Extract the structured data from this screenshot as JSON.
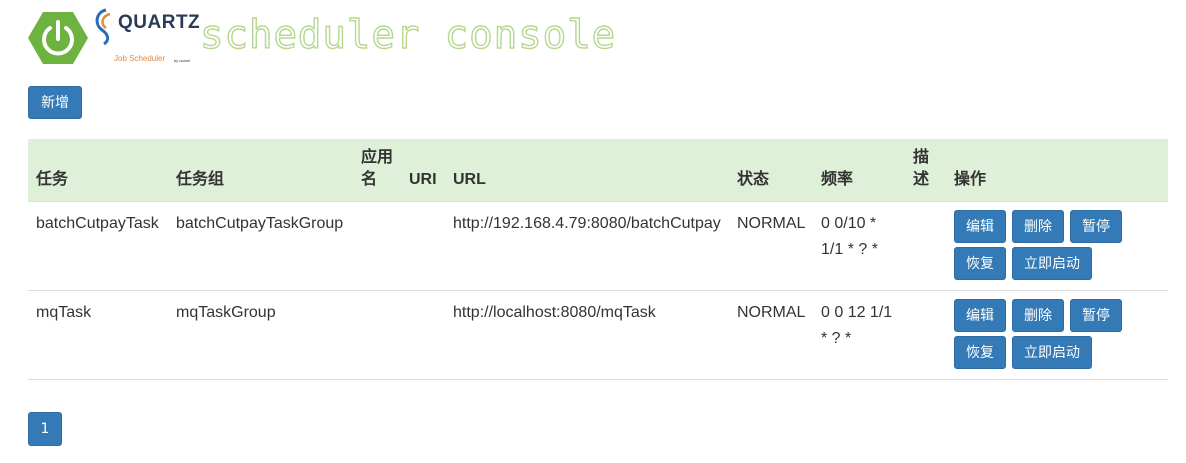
{
  "header": {
    "quartz_logo_text": "QUARTZ",
    "quartz_logo_sub": "Job Scheduler",
    "quartz_logo_mini": "by ocaml",
    "console_title": "scheduler console"
  },
  "toolbar": {
    "add_label": "新增"
  },
  "table": {
    "columns": [
      "任务",
      "任务组",
      "应用名",
      "URI",
      "URL",
      "状态",
      "频率",
      "描述",
      "操作"
    ],
    "rows": [
      {
        "task": "batchCutpayTask",
        "group": "batchCutpayTaskGroup",
        "app": "",
        "uri": "",
        "url": "http://192.168.4.79:8080/batchCutpay",
        "status": "NORMAL",
        "cron": "0 0/10 * 1/1 * ? *",
        "desc": "",
        "actions": [
          "编辑",
          "删除",
          "暂停",
          "恢复",
          "立即启动"
        ]
      },
      {
        "task": "mqTask",
        "group": "mqTaskGroup",
        "app": "",
        "uri": "",
        "url": "http://localhost:8080/mqTask",
        "status": "NORMAL",
        "cron": "0 0 12 1/1 * ? *",
        "desc": "",
        "actions": [
          "编辑",
          "删除",
          "暂停",
          "恢复",
          "立即启动"
        ]
      }
    ]
  },
  "pagination": {
    "current_page": "1"
  },
  "colors": {
    "primary": "#337ab7",
    "header_row": "#dff0d8",
    "spring_green": "#6db33f",
    "console_title": "#b5d890"
  }
}
